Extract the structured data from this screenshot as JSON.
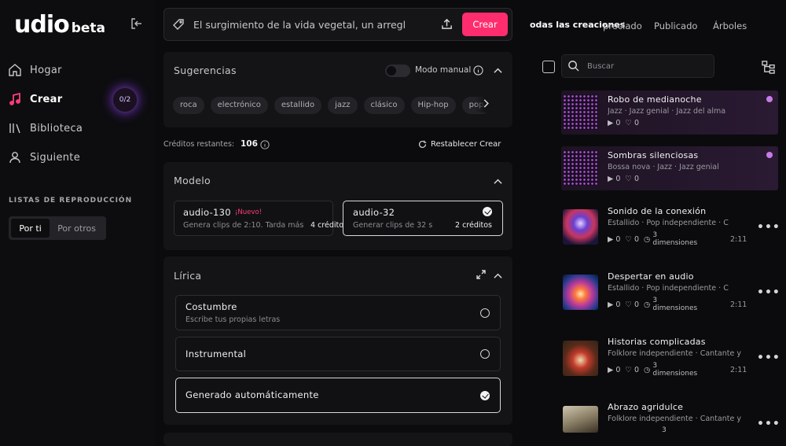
{
  "brand": {
    "logo": "udio",
    "tag": "beta"
  },
  "sidebar": {
    "nav": [
      {
        "label": "Hogar",
        "icon": "home-icon"
      },
      {
        "label": "Crear",
        "icon": "music-note-icon",
        "active": true
      },
      {
        "label": "Biblioteca",
        "icon": "library-icon"
      },
      {
        "label": "Siguiente",
        "icon": "user-icon"
      }
    ],
    "create_badge": "0/2",
    "playlists_title": "LISTAS DE REPRODUCCIÓN",
    "seg_for_you": "Por ti",
    "seg_by_others": "Por otros"
  },
  "prompt": {
    "value": "El surgimiento de la vida vegetal, un arreglo",
    "create_label": "Crear"
  },
  "suggestions": {
    "title": "Sugerencias",
    "manual_label": "Modo manual",
    "chips": [
      "roca",
      "electrónico",
      "estallido",
      "jazz",
      "clásico",
      "Hip-hop",
      "pop"
    ]
  },
  "credits": {
    "label": "Créditos restantes:",
    "value": "106",
    "reset_label": "Restablecer Crear"
  },
  "model": {
    "title": "Modelo",
    "options": [
      {
        "name": "audio-130",
        "badge": "¡Nuevo!",
        "desc": "Genera clips de 2:10. Tarda más",
        "cost": "4 créditos"
      },
      {
        "name": "audio-32",
        "desc": "Generar clips de 32 s",
        "cost": "2 créditos",
        "selected": true
      }
    ]
  },
  "lyrics": {
    "title": "Lírica",
    "options": [
      {
        "name": "Costumbre",
        "desc": "Escribe tus propias letras"
      },
      {
        "name": "Instrumental",
        "desc": ""
      },
      {
        "name": "Generado automáticamente",
        "desc": "",
        "selected": true
      }
    ]
  },
  "right": {
    "tabs": [
      "odas las creaciones",
      "preciado",
      "Publicado",
      "Árboles"
    ],
    "search_placeholder": "Buscar",
    "songs": [
      {
        "title": "Robo de medianoche",
        "tags": [
          "Jazz",
          "Jazz genial",
          "Jazz del alma"
        ],
        "plays": "0",
        "likes": "0",
        "highlight": true,
        "thumb": "dots"
      },
      {
        "title": "Sombras silenciosas",
        "tags": [
          "Bossa nova",
          "Jazz",
          "Jazz genial"
        ],
        "plays": "0",
        "likes": "0",
        "highlight": true,
        "thumb": "dots"
      },
      {
        "title": "Sonido de la conexión",
        "tags": [
          "Estallido",
          "Pop independiente",
          "C"
        ],
        "plays": "0",
        "likes": "0",
        "dims": "3",
        "dims_label": "dimensiones",
        "time": "2:11",
        "thumb": "cosmic"
      },
      {
        "title": "Despertar en audio",
        "tags": [
          "Estallido",
          "Pop independiente",
          "C"
        ],
        "plays": "0",
        "likes": "0",
        "dims": "3",
        "dims_label": "dimensiones",
        "time": "2:11",
        "thumb": "cosmic2"
      },
      {
        "title": "Historias complicadas",
        "tags": [
          "Folklore independiente",
          "Cantante y"
        ],
        "plays": "0",
        "likes": "0",
        "dims": "3",
        "dims_label": "dimensiones",
        "time": "2:11",
        "thumb": "apple"
      },
      {
        "title": "Abrazo agridulce",
        "tags": [
          "Folklore independiente",
          "Cantante y"
        ],
        "plays": "",
        "likes": "",
        "dims": "3",
        "dims_label": "",
        "time": "",
        "thumb": "branch"
      }
    ]
  },
  "colors": {
    "accent": "#ff2d6e",
    "highlight": "#c67be8"
  }
}
